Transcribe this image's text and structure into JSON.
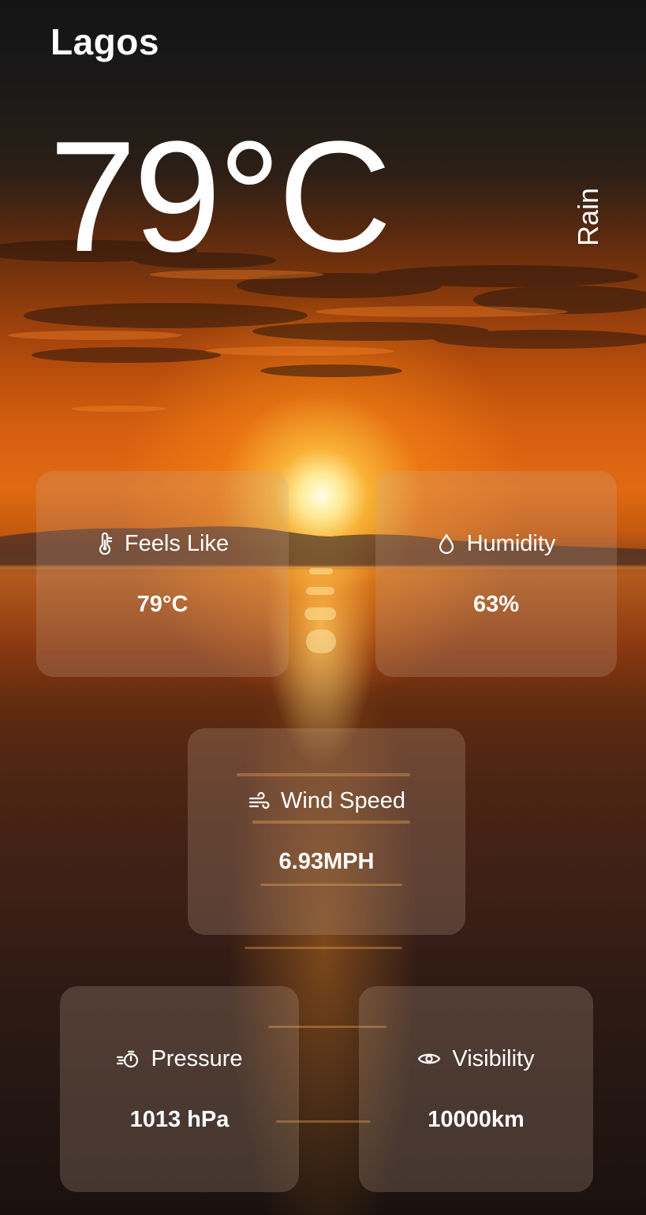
{
  "location": {
    "city": "Lagos"
  },
  "current": {
    "temperature": "79°C",
    "condition": "Rain"
  },
  "cards": {
    "feels_like": {
      "label": "Feels Like",
      "value": "79°C",
      "icon": "thermometer-icon"
    },
    "humidity": {
      "label": "Humidity",
      "value": "63%",
      "icon": "droplet-icon"
    },
    "wind_speed": {
      "label": "Wind Speed",
      "value": "6.93MPH",
      "icon": "wind-icon"
    },
    "pressure": {
      "label": "Pressure",
      "value": "1013 hPa",
      "icon": "gauge-icon"
    },
    "visibility": {
      "label": "Visibility",
      "value": "10000km",
      "icon": "eye-icon"
    }
  },
  "colors": {
    "text": "#ffffff",
    "card_background": "rgba(200,170,150,0.24)",
    "sun_glow": "#ffb23c"
  }
}
